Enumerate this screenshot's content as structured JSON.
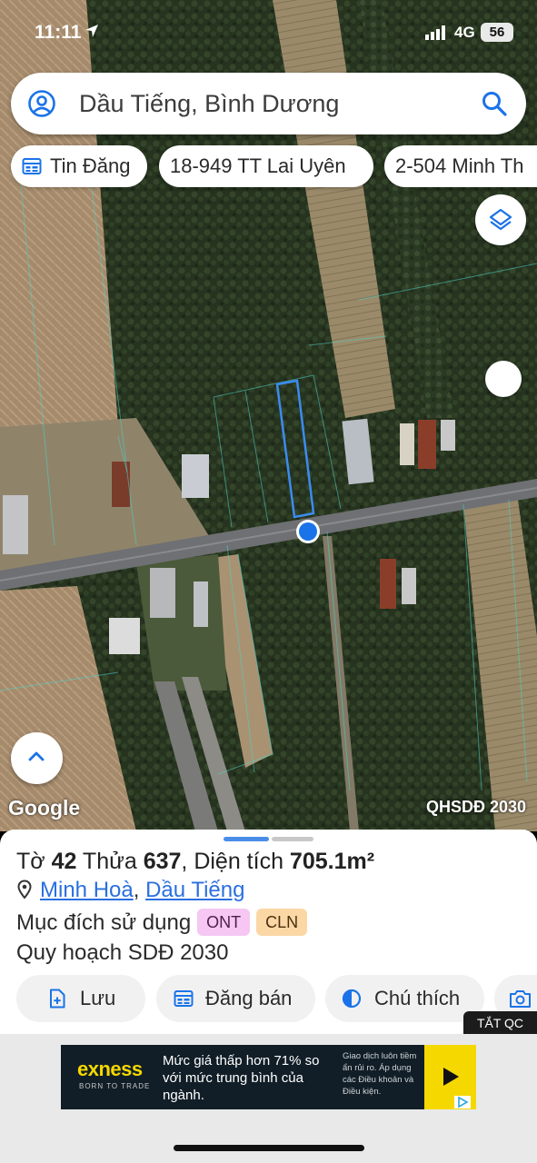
{
  "status_bar": {
    "time": "11:11",
    "network": "4G",
    "battery": "56"
  },
  "search": {
    "text": "Dầu Tiếng, Bình Dương"
  },
  "chips": [
    {
      "label": "Tin Đăng",
      "icon": "listing-icon"
    },
    {
      "label": "18-949 TT Lai Uyên"
    },
    {
      "label": "2-504 Minh Th"
    }
  ],
  "map": {
    "attribution": "Google",
    "caption": "QHSDĐ 2030",
    "parcel_outline_color": "#3b8cf0",
    "location_dot_color": "#1a73e8"
  },
  "parcel": {
    "title_prefix": "Tờ ",
    "sheet_no": "42",
    "plot_label": " Thửa ",
    "plot_no": "637",
    "area_label": ", Diện tích ",
    "area_value": "705.1m²",
    "commune": "Minh Hoà",
    "comma": ",",
    "district": "Dầu Tiếng",
    "purpose_label": "Mục đích sử dụng",
    "purpose_tags": [
      "ONT",
      "CLN"
    ],
    "plan_label": "Quy hoạch SDĐ 2030"
  },
  "actions": [
    {
      "label": "Lưu",
      "icon": "save-file-icon"
    },
    {
      "label": "Đăng bán",
      "icon": "post-listing-icon"
    },
    {
      "label": "Chú thích",
      "icon": "legend-contrast-icon"
    },
    {
      "label": "",
      "icon": "camera-icon"
    }
  ],
  "hide_ad_label": "TẮT QC",
  "ad": {
    "brand": "exness",
    "slogan": "BORN TO TRADE",
    "headline": "Mức giá thấp hơn 71% so với mức trung bình của ngành.",
    "disclaimer": "Giao dịch luôn tiềm ẩn rủi ro. Áp dụng các Điều khoản và Điều kiện.",
    "accent_color": "#f5d800"
  }
}
